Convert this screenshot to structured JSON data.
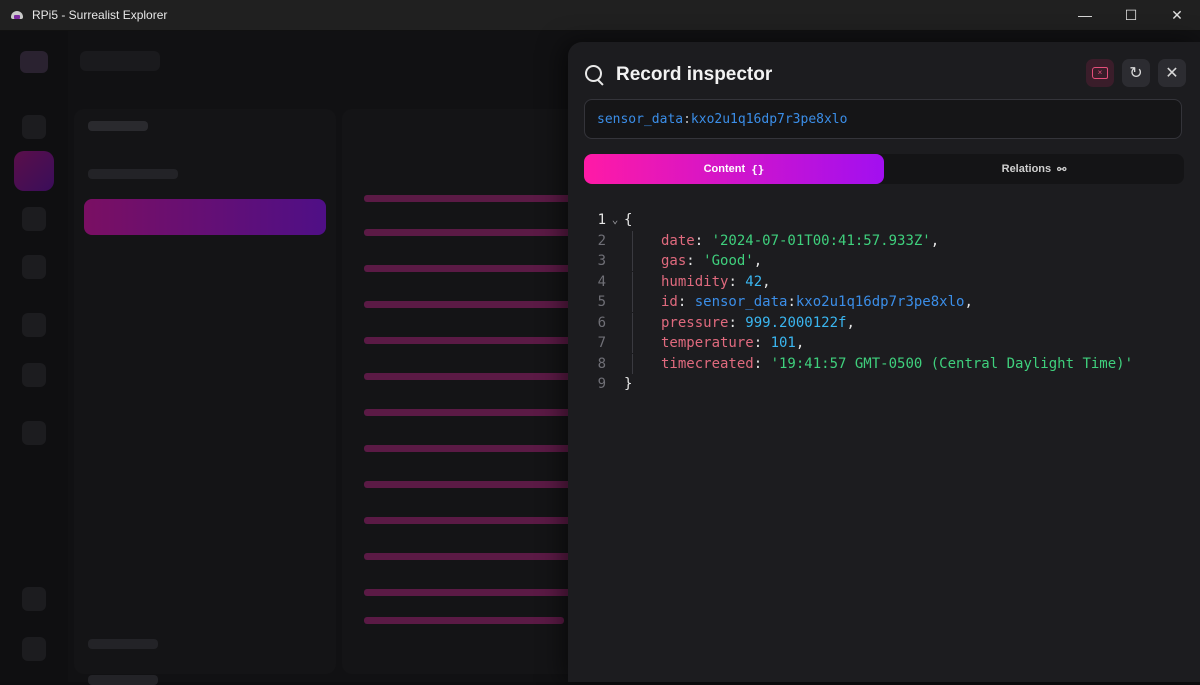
{
  "window": {
    "title": "RPi5 - Surrealist Explorer",
    "controls": {
      "minimize": "—",
      "maximize": "☐",
      "close": "✕"
    }
  },
  "inspector": {
    "title": "Record inspector",
    "record_id": {
      "table": "sensor_data",
      "separator": ":",
      "key": "kxo2u1q16dp7r3pe8xlo"
    },
    "tabs": [
      {
        "label": "Content",
        "icon": "{}"
      },
      {
        "label": "Relations",
        "icon": "⚯"
      }
    ],
    "buttons": {
      "delete_icon": "tag-x-icon",
      "refresh_icon": "↻",
      "close_icon": "✕"
    },
    "code": {
      "line_numbers": [
        "1",
        "2",
        "3",
        "4",
        "5",
        "6",
        "7",
        "8",
        "9"
      ],
      "open_brace": "{",
      "close_brace": "}",
      "fields": [
        {
          "key": "date",
          "colon": ": ",
          "value": "'2024-07-01T00:41:57.933Z'",
          "suffix": ","
        },
        {
          "key": "gas",
          "colon": ": ",
          "value": "'Good'",
          "suffix": ","
        },
        {
          "key": "humidity",
          "colon": ": ",
          "value": "42",
          "suffix": ","
        },
        {
          "key": "id",
          "colon": ": ",
          "value_table": "sensor_data",
          "value_sep": ":",
          "value_key": "kxo2u1q16dp7r3pe8xlo",
          "suffix": ","
        },
        {
          "key": "pressure",
          "colon": ": ",
          "value": "999.2000122f",
          "suffix": ","
        },
        {
          "key": "temperature",
          "colon": ": ",
          "value": "101",
          "suffix": ","
        },
        {
          "key": "timecreated",
          "colon": ": ",
          "value": "'19:41:57 GMT-0500 (Central Daylight Time)'",
          "suffix": ""
        }
      ]
    }
  },
  "colors": {
    "accent_start": "#ff1aa6",
    "accent_end": "#a20ff0",
    "string": "#3fd07d",
    "number": "#3ab6f0",
    "key": "#e06a7e",
    "record_link": "#3b8ee8"
  }
}
